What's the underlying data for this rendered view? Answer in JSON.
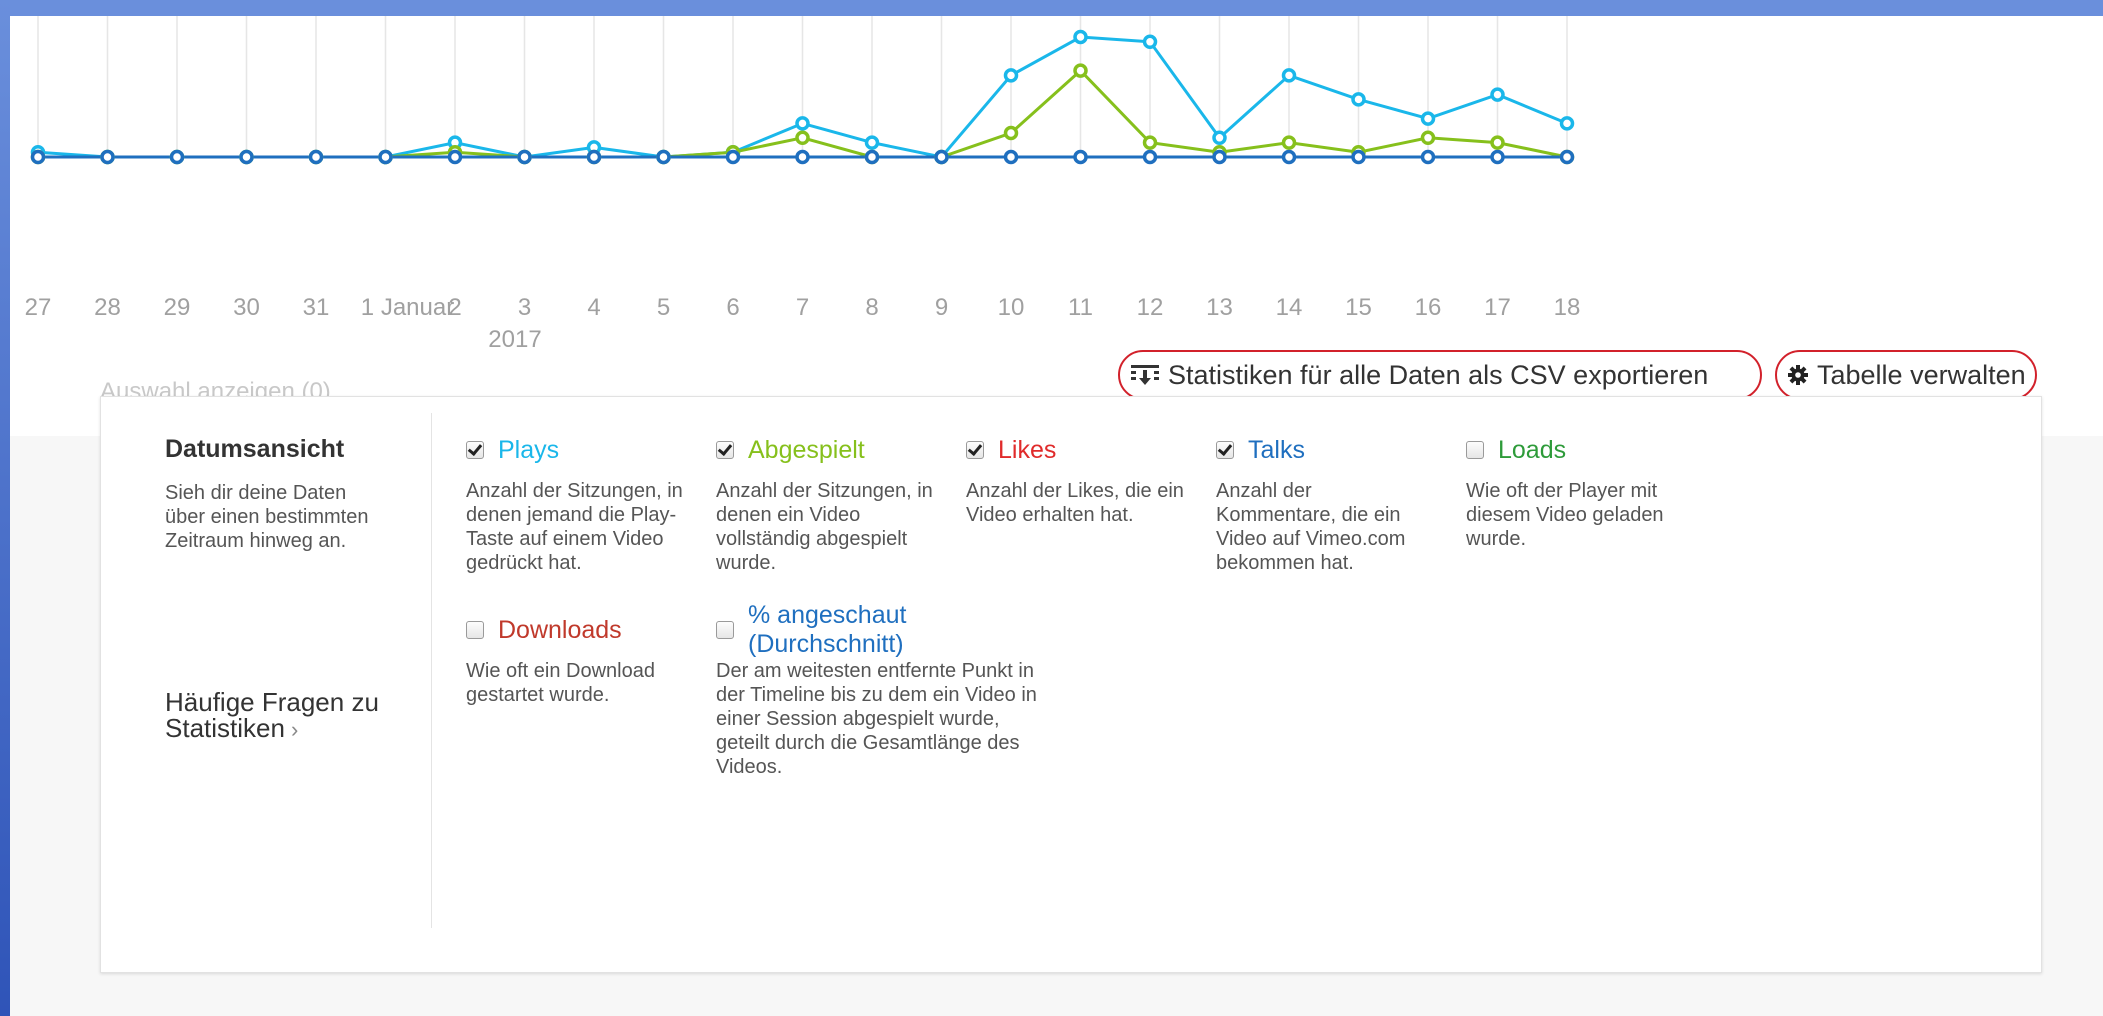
{
  "chart_data": {
    "type": "line",
    "x": [
      "27",
      "28",
      "29",
      "30",
      "31",
      "1 Januar",
      "2",
      "3",
      "4",
      "5",
      "6",
      "7",
      "8",
      "9",
      "10",
      "11",
      "12",
      "13",
      "14",
      "15",
      "16",
      "17",
      "18"
    ],
    "year_label": "2017",
    "series": [
      {
        "name": "Plays",
        "color": "#1ab7ea",
        "values": [
          1,
          0,
          0,
          0,
          0,
          0,
          3,
          0,
          2,
          0,
          1,
          7,
          3,
          0,
          17,
          25,
          24,
          4,
          17,
          12,
          8,
          13,
          7
        ]
      },
      {
        "name": "Abgespielt",
        "color": "#86c01c",
        "values": [
          0,
          0,
          0,
          0,
          0,
          0,
          1,
          0,
          0,
          0,
          1,
          4,
          0,
          0,
          5,
          18,
          3,
          1,
          3,
          1,
          4,
          3,
          0
        ]
      },
      {
        "name": "Likes",
        "color": "#1f6fbf",
        "values": [
          0,
          0,
          0,
          0,
          0,
          0,
          0,
          0,
          0,
          0,
          0,
          0,
          0,
          0,
          0,
          0,
          0,
          0,
          0,
          0,
          0,
          0,
          0
        ]
      }
    ],
    "grid": true,
    "ylabel": "",
    "xlabel": ""
  },
  "show_selection": "Auswahl anzeigen (0)",
  "toolbar": {
    "export_csv_label": "Statistiken für alle Daten als CSV exportieren",
    "manage_table_label": "Tabelle verwalten"
  },
  "panel": {
    "heading": "Datumsansicht",
    "description": "Sieh dir deine Daten über einen bestimmten Zeitraum hinweg an.",
    "faq_link": "Häufige Fragen zu Statistiken",
    "metrics": [
      {
        "label": "Plays",
        "checked": true,
        "color": "#1ab7ea",
        "description": "Anzahl der Sitzungen, in denen jemand die Play-Taste auf einem Video gedrückt hat."
      },
      {
        "label": "Abgespielt",
        "checked": true,
        "color": "#86c01c",
        "description": "Anzahl der Sitzungen, in denen ein Video vollständig abgespielt wurde."
      },
      {
        "label": "Likes",
        "checked": true,
        "color": "#e02b2b",
        "description": "Anzahl der Likes, die ein Video erhalten hat."
      },
      {
        "label": "Talks",
        "checked": true,
        "color": "#1f6fbf",
        "description": "Anzahl der Kommentare, die ein Video auf Vimeo.com bekommen hat."
      },
      {
        "label": "Loads",
        "checked": false,
        "color": "#2e9b3a",
        "description": "Wie oft der Player mit diesem Video geladen wurde."
      },
      {
        "label": "Downloads",
        "checked": false,
        "color": "#c0392b",
        "description": "Wie oft ein Download gestartet wurde."
      },
      {
        "label": "% angeschaut (Durchschnitt)",
        "checked": false,
        "color": "#1f6fbf",
        "description": "Der am weitesten entfernte Punkt in der Timeline bis zu dem ein Video in einer Session abgespielt wurde, geteilt durch die Gesamtlänge des Videos."
      }
    ]
  }
}
